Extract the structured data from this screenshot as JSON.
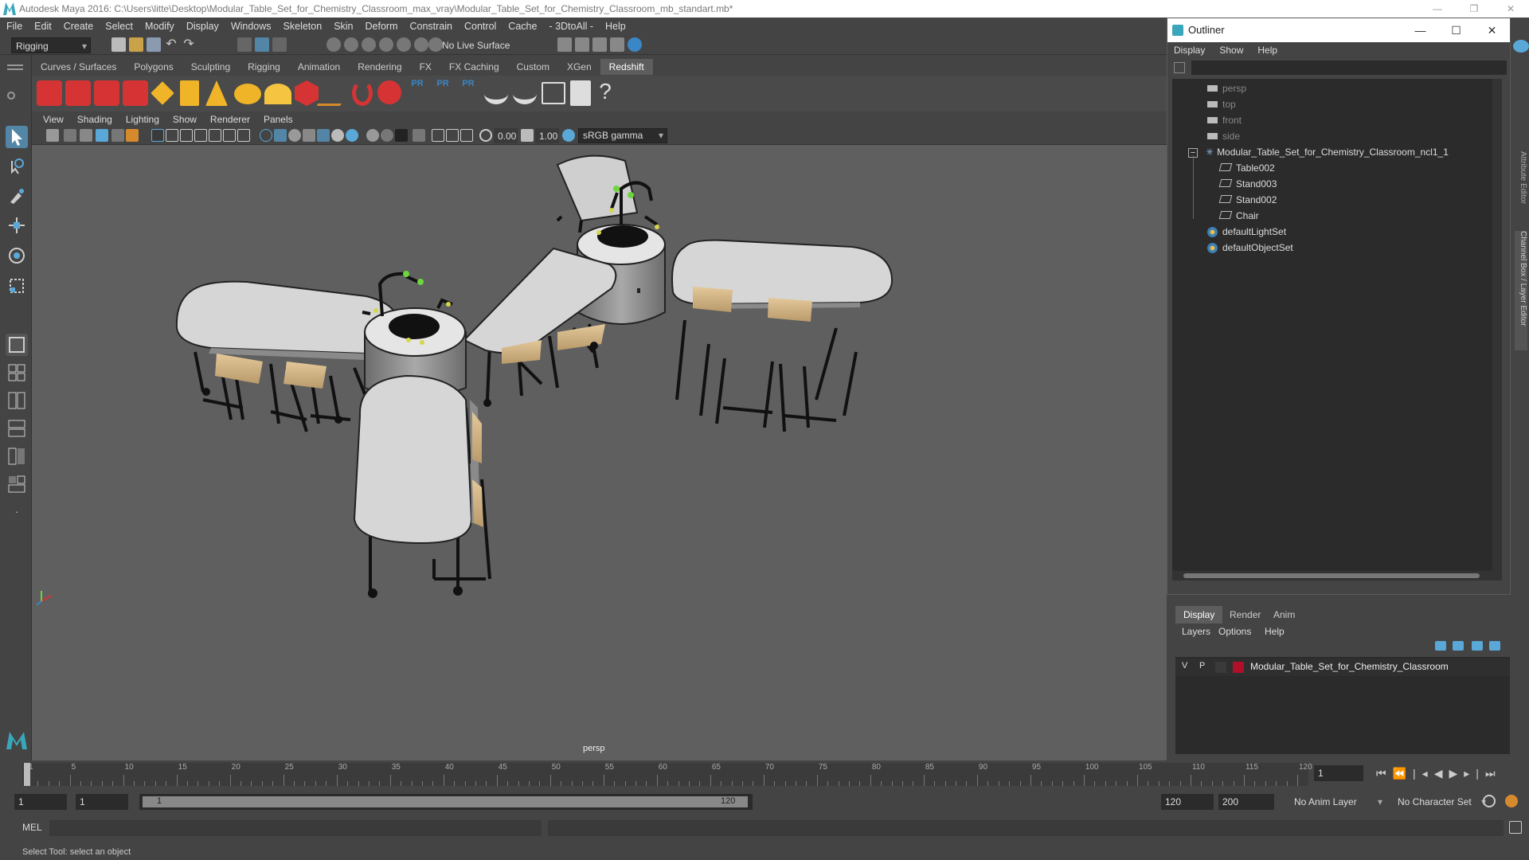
{
  "window": {
    "title": "Autodesk Maya 2016: C:\\Users\\litte\\Desktop\\Modular_Table_Set_for_Chemistry_Classroom_max_vray\\Modular_Table_Set_for_Chemistry_Classroom_mb_standart.mb*"
  },
  "menubar": [
    "File",
    "Edit",
    "Create",
    "Select",
    "Modify",
    "Display",
    "Windows",
    "Skeleton",
    "Skin",
    "Deform",
    "Constrain",
    "Control",
    "Cache",
    "- 3DtoAll -",
    "Help"
  ],
  "statusline": {
    "mode": "Rigging",
    "live_surface": "No Live Surface"
  },
  "shelf_tabs": [
    "Curves / Surfaces",
    "Polygons",
    "Sculpting",
    "Rigging",
    "Animation",
    "Rendering",
    "FX",
    "FX Caching",
    "Custom",
    "XGen",
    "Redshift"
  ],
  "active_shelf": "Redshift",
  "viewport_menu": [
    "View",
    "Shading",
    "Lighting",
    "Show",
    "Renderer",
    "Panels"
  ],
  "viewport_toolbar": {
    "exposure": "0.00",
    "gamma": "1.00",
    "color_space": "sRGB gamma"
  },
  "viewport": {
    "camera_label": "persp"
  },
  "outliner": {
    "title": "Outliner",
    "menu": [
      "Display",
      "Show",
      "Help"
    ],
    "items": [
      {
        "label": "persp",
        "type": "camera"
      },
      {
        "label": "top",
        "type": "camera"
      },
      {
        "label": "front",
        "type": "camera"
      },
      {
        "label": "side",
        "type": "camera"
      },
      {
        "label": "Modular_Table_Set_for_Chemistry_Classroom_ncl1_1",
        "type": "group"
      },
      {
        "label": "Table002",
        "type": "mesh"
      },
      {
        "label": "Stand003",
        "type": "mesh"
      },
      {
        "label": "Stand002",
        "type": "mesh"
      },
      {
        "label": "Chair",
        "type": "mesh"
      },
      {
        "label": "defaultLightSet",
        "type": "set"
      },
      {
        "label": "defaultObjectSet",
        "type": "set"
      }
    ]
  },
  "layer_editor": {
    "tabs": [
      "Display",
      "Render",
      "Anim"
    ],
    "menu": [
      "Layers",
      "Options",
      "Help"
    ],
    "layer": {
      "v": "V",
      "p": "P",
      "name": "Modular_Table_Set_for_Chemistry_Classroom",
      "color": "#b0102a"
    }
  },
  "side_tabs": [
    "Attribute Editor",
    "Channel Box / Layer Editor"
  ],
  "timeline": {
    "ticks": [
      "1",
      "5",
      "10",
      "15",
      "20",
      "25",
      "30",
      "35",
      "40",
      "45",
      "50",
      "55",
      "60",
      "65",
      "70",
      "75",
      "80",
      "85",
      "90",
      "95",
      "100",
      "105",
      "110",
      "115",
      "120"
    ],
    "current_frame": "1"
  },
  "range": {
    "start": "1",
    "playback_start": "1",
    "slider_start": "1",
    "slider_end": "120",
    "playback_end": "120",
    "end": "200",
    "anim_layer": "No Anim Layer",
    "character_set": "No Character Set"
  },
  "cmdline": {
    "label": "MEL"
  },
  "helpline": {
    "text": "Select Tool: select an object"
  },
  "colors": {
    "accent": "#5285a6",
    "bg": "#444444",
    "viewport": "#5f5f5f"
  }
}
